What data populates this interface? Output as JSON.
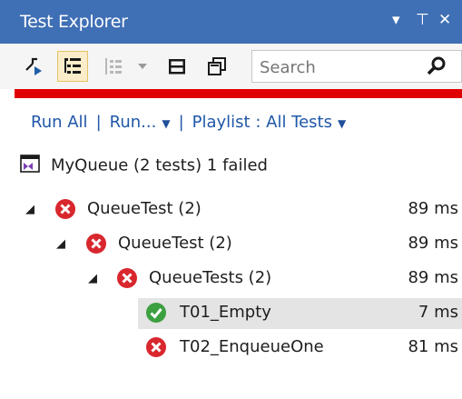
{
  "panel": {
    "title": "Test Explorer",
    "pin_glyph": "⊤",
    "close_glyph": "✕"
  },
  "toolbar": {
    "search_placeholder": "Search",
    "icons": [
      "run-tests-icon",
      "group-by-icon",
      "playlist-icon",
      "dropdown-icon",
      "filter-icon",
      "copy-icon",
      "search-icon"
    ]
  },
  "commands": {
    "run_all": "Run All",
    "run": "Run...",
    "playlist": "Playlist : All Tests"
  },
  "summary": {
    "text": "MyQueue (2 tests) 1 failed"
  },
  "tree": [
    {
      "name": "QueueTest (2)",
      "duration": "89 ms",
      "status": "failed",
      "level": 0
    },
    {
      "name": "QueueTest (2)",
      "duration": "89 ms",
      "status": "failed",
      "level": 1
    },
    {
      "name": "QueueTests (2)",
      "duration": "89 ms",
      "status": "failed",
      "level": 2
    },
    {
      "name": "T01_Empty",
      "duration": "7 ms",
      "status": "passed",
      "level": 3
    },
    {
      "name": "T02_EnqueueOne",
      "duration": "81 ms",
      "status": "failed",
      "level": 3
    }
  ],
  "colors": {
    "titlebar": "#3f6fb5",
    "link": "#1f57a8",
    "failed": "#d9272e",
    "passed": "#3c9f40",
    "error_bar": "#e00000"
  }
}
